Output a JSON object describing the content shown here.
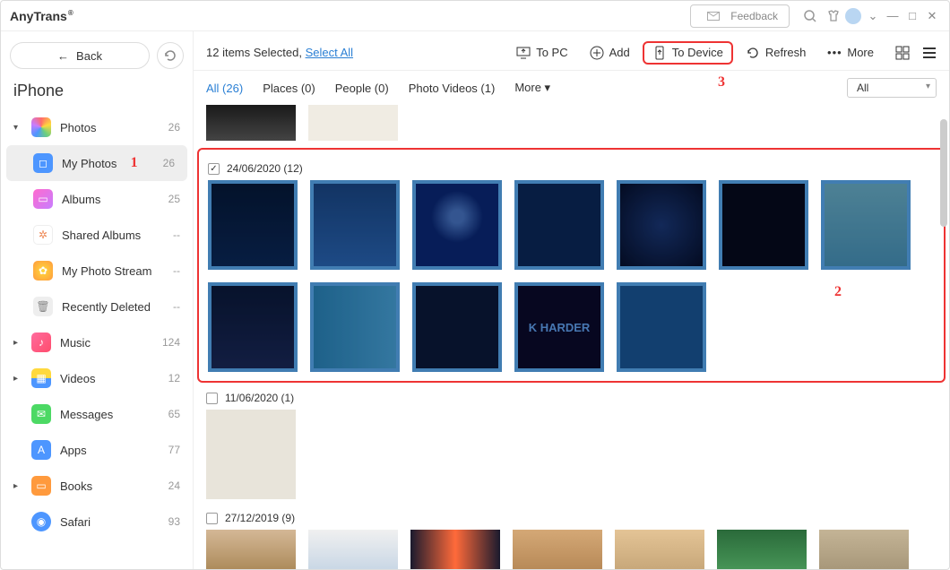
{
  "app": {
    "name": "AnyTrans",
    "reg": "®"
  },
  "titlebar": {
    "feedback": "Feedback"
  },
  "sidebar": {
    "back": "Back",
    "device": "iPhone",
    "items": [
      {
        "label": "Photos",
        "count": "26",
        "caret": "▾"
      },
      {
        "label": "My Photos",
        "count": "26",
        "annot": "1"
      },
      {
        "label": "Albums",
        "count": "25"
      },
      {
        "label": "Shared Albums",
        "count": "--"
      },
      {
        "label": "My Photo Stream",
        "count": "--"
      },
      {
        "label": "Recently Deleted",
        "count": "--"
      },
      {
        "label": "Music",
        "count": "124",
        "caret": "▸"
      },
      {
        "label": "Videos",
        "count": "12",
        "caret": "▸"
      },
      {
        "label": "Messages",
        "count": "65"
      },
      {
        "label": "Apps",
        "count": "77"
      },
      {
        "label": "Books",
        "count": "24",
        "caret": "▸"
      },
      {
        "label": "Safari",
        "count": "93"
      }
    ]
  },
  "toolbar": {
    "selected_text": "12 items Selected, ",
    "select_all": "Select All",
    "to_pc": "To PC",
    "add": "Add",
    "to_device": "To Device",
    "refresh": "Refresh",
    "more": "More",
    "annot3": "3"
  },
  "filters": {
    "all": "All (26)",
    "places": "Places (0)",
    "people": "People (0)",
    "photo_videos": "Photo Videos (1)",
    "more": "More",
    "dd": "All"
  },
  "groups": {
    "g1": {
      "date": "24/06/2020 (12)",
      "annot": "2"
    },
    "g2": {
      "date": "11/06/2020 (1)"
    },
    "g3": {
      "date": "27/12/2019 (9)"
    }
  }
}
